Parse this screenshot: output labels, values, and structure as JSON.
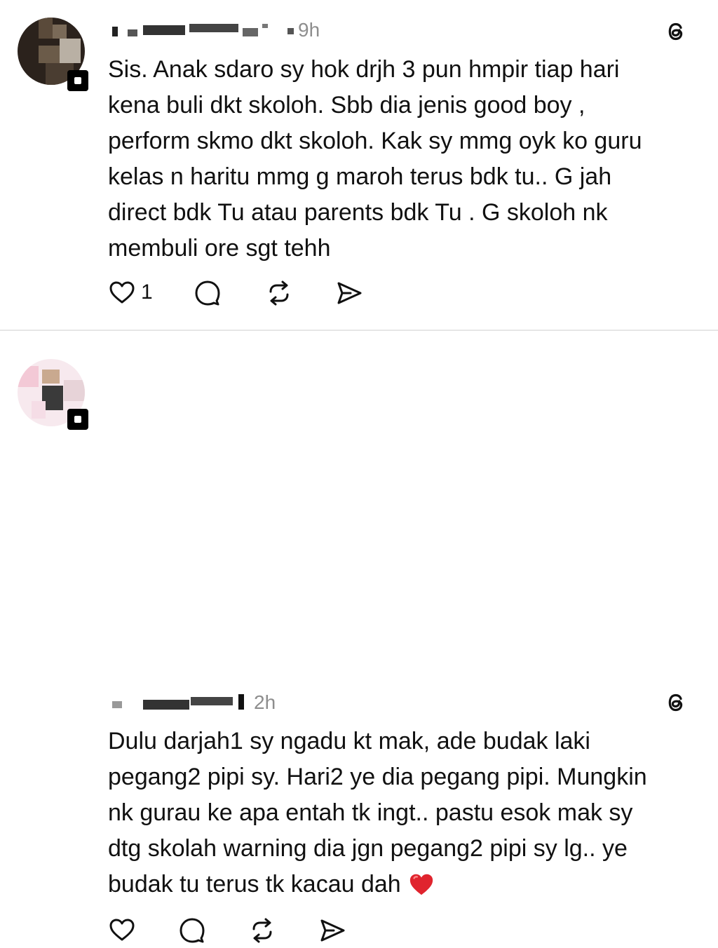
{
  "posts": [
    {
      "time": "9h",
      "lines": [
        "Sis. Anak sdaro sy hok drjh 3 pun hmpir tiap hari",
        "kena buli dkt skoloh. Sbb dia jenis good boy ,",
        "perform skmo dkt skoloh. Kak sy mmg oyk ko guru",
        "kelas n haritu mmg g maroh terus bdk tu.. G jah",
        "direct bdk Tu atau parents bdk Tu . G skoloh nk",
        "membuli ore sgt tehh"
      ],
      "like_count": "1",
      "icons": [
        "threads-logo-icon",
        "heart-icon",
        "comment-icon",
        "repost-icon",
        "share-icon"
      ]
    },
    {
      "time": "2h",
      "lines": [
        "Dulu darjah1 sy ngadu kt mak, ade budak laki",
        "pegang2 pipi sy. Hari2 ye dia pegang pipi. Mungkin",
        "nk gurau ke apa entah tk ingt.. pastu esok mak sy",
        "dtg skolah warning dia jgn pegang2 pipi sy lg.. ye",
        "budak tu terus tk kacau dah"
      ],
      "trailing_emoji": "red-heart-emoji",
      "icons": [
        "threads-logo-icon",
        "heart-icon",
        "comment-icon",
        "repost-icon",
        "share-icon"
      ]
    }
  ],
  "colors": {
    "text": "#111111",
    "meta": "#8e8e8e",
    "divider": "#e6e6e6",
    "heart_red": "#e0242e"
  }
}
